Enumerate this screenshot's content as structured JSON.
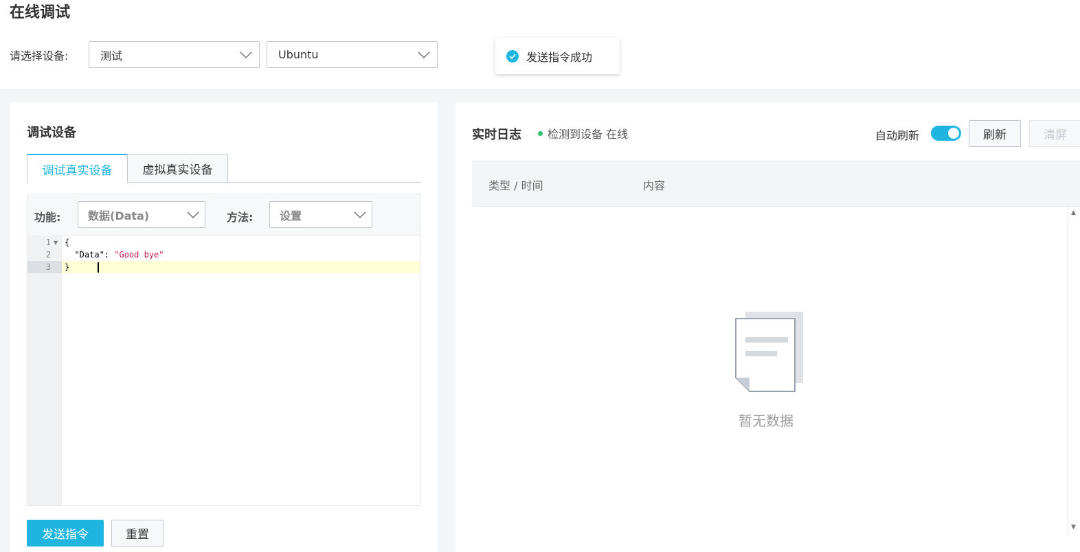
{
  "page": {
    "title": "在线调试"
  },
  "device_select": {
    "label": "请选择设备:",
    "product_value": "测试",
    "device_value": "Ubuntu"
  },
  "toast": {
    "text": "发送指令成功",
    "icon": "check-circle-icon"
  },
  "debug_panel": {
    "title": "调试设备",
    "tabs": [
      {
        "label": "调试真实设备",
        "active": true
      },
      {
        "label": "虚拟真实设备",
        "active": false
      }
    ],
    "function_label": "功能:",
    "function_value": "数据(Data)",
    "method_label": "方法:",
    "method_value": "设置",
    "code_lines": [
      {
        "num": "1",
        "text": "{"
      },
      {
        "num": "2",
        "key": "  \"Data\": ",
        "value": "\"Good bye\""
      },
      {
        "num": "3",
        "text": "}"
      }
    ],
    "send_button": "发送指令",
    "reset_button": "重置"
  },
  "log_panel": {
    "title": "实时日志",
    "status": "检测到设备 在线",
    "auto_refresh_label": "自动刷新",
    "auto_refresh_on": true,
    "refresh_button": "刷新",
    "clear_button": "清屏",
    "columns": [
      "类型 / 时间",
      "内容"
    ],
    "empty_text": "暂无数据"
  },
  "colors": {
    "accent": "#1fb5e0",
    "online": "#36c16a",
    "string": "#c41a4a"
  }
}
